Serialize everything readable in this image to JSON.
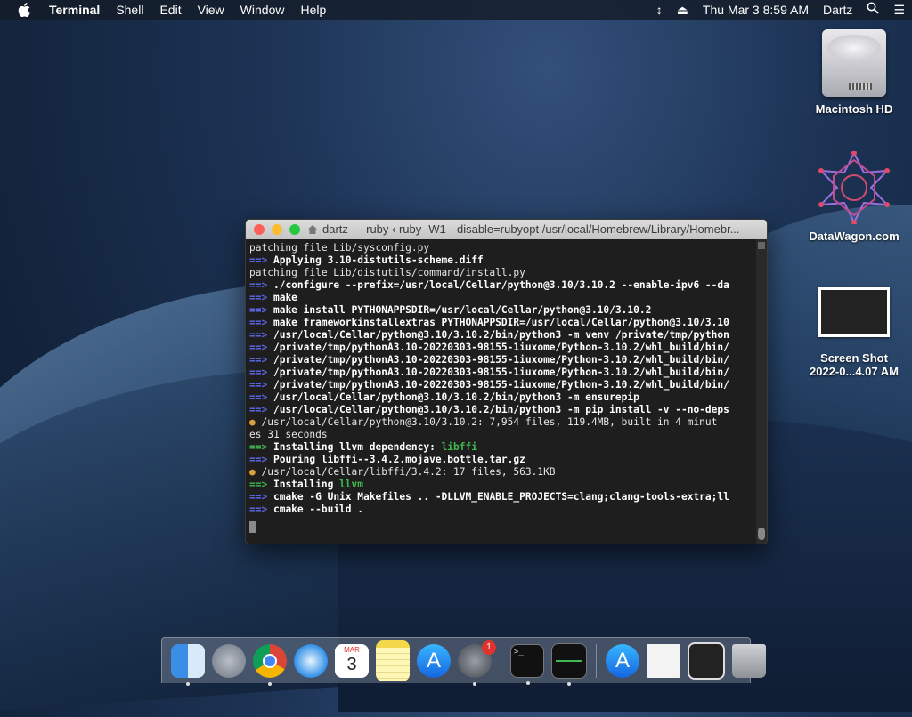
{
  "menubar": {
    "app_name": "Terminal",
    "menus": [
      "Shell",
      "Edit",
      "View",
      "Window",
      "Help"
    ],
    "clock": "Thu Mar 3  8:59 AM",
    "user": "Dartz",
    "icons": [
      "apple-icon",
      "scroll-arrows-icon",
      "eject-icon",
      "spotlight-icon",
      "notification-list-icon"
    ]
  },
  "desktop": {
    "icons": [
      {
        "label": "Macintosh HD",
        "icon": "hard-drive-icon"
      },
      {
        "label": "DataWagon.com",
        "icon": "datawagon-icon"
      },
      {
        "label_line1": "Screen Shot",
        "label_line2": "2022-0...4.07 AM",
        "icon": "screenshot-file-icon"
      }
    ]
  },
  "terminal": {
    "title": "dartz — ruby ‹ ruby -W1 --disable=rubyopt /usr/local/Homebrew/Library/Homebr...",
    "lines": [
      {
        "t": "plain",
        "text": "patching file Lib/sysconfig.py"
      },
      {
        "t": "arrow",
        "text": "Applying 3.10-distutils-scheme.diff"
      },
      {
        "t": "plain",
        "text": "patching file Lib/distutils/command/install.py"
      },
      {
        "t": "arrow",
        "text": "./configure --prefix=/usr/local/Cellar/python@3.10/3.10.2 --enable-ipv6 --da"
      },
      {
        "t": "arrow",
        "text": "make"
      },
      {
        "t": "arrow",
        "text": "make install PYTHONAPPSDIR=/usr/local/Cellar/python@3.10/3.10.2"
      },
      {
        "t": "arrow",
        "text": "make frameworkinstallextras PYTHONAPPSDIR=/usr/local/Cellar/python@3.10/3.10"
      },
      {
        "t": "arrow",
        "text": "/usr/local/Cellar/python@3.10/3.10.2/bin/python3 -m venv /private/tmp/python"
      },
      {
        "t": "arrow",
        "text": "/private/tmp/pythonA3.10-20220303-98155-1iuxome/Python-3.10.2/whl_build/bin/"
      },
      {
        "t": "arrow",
        "text": "/private/tmp/pythonA3.10-20220303-98155-1iuxome/Python-3.10.2/whl_build/bin/"
      },
      {
        "t": "arrow",
        "text": "/private/tmp/pythonA3.10-20220303-98155-1iuxome/Python-3.10.2/whl_build/bin/"
      },
      {
        "t": "arrow",
        "text": "/private/tmp/pythonA3.10-20220303-98155-1iuxome/Python-3.10.2/whl_build/bin/"
      },
      {
        "t": "arrow",
        "text": "/usr/local/Cellar/python@3.10/3.10.2/bin/python3 -m ensurepip"
      },
      {
        "t": "arrow",
        "text": "/usr/local/Cellar/python@3.10/3.10.2/bin/python3 -m pip install -v --no-deps"
      },
      {
        "t": "beer",
        "text": "/usr/local/Cellar/python@3.10/3.10.2: 7,954 files, 119.4MB, built in 4 minut"
      },
      {
        "t": "plain",
        "text": "es 31 seconds"
      },
      {
        "t": "garrow",
        "text": "Installing llvm dependency: ",
        "hl": "libffi"
      },
      {
        "t": "arrow",
        "text": "Pouring libffi--3.4.2.mojave.bottle.tar.gz"
      },
      {
        "t": "beer",
        "text": "/usr/local/Cellar/libffi/3.4.2: 17 files, 563.1KB"
      },
      {
        "t": "garrow",
        "text": "Installing ",
        "hl": "llvm"
      },
      {
        "t": "arrow",
        "text": "cmake -G Unix Makefiles .. -DLLVM_ENABLE_PROJECTS=clang;clang-tools-extra;ll"
      },
      {
        "t": "arrow",
        "text": "cmake --build ."
      }
    ],
    "prompt_marker": "==>",
    "beer_glyph": "🍺"
  },
  "dock": {
    "apps": [
      {
        "name": "Finder",
        "icon": "finder-icon",
        "running": true
      },
      {
        "name": "Launchpad",
        "icon": "launchpad-icon",
        "running": false
      },
      {
        "name": "Google Chrome",
        "icon": "chrome-icon",
        "running": true
      },
      {
        "name": "Safari",
        "icon": "safari-icon",
        "running": false
      },
      {
        "name": "Calendar",
        "icon": "calendar-icon",
        "running": false,
        "month": "MAR",
        "day": "3"
      },
      {
        "name": "Notes",
        "icon": "notes-icon",
        "running": false
      },
      {
        "name": "App Store",
        "icon": "app-store-icon",
        "running": false
      },
      {
        "name": "System Preferences",
        "icon": "system-preferences-icon",
        "running": true,
        "badge": "1"
      },
      {
        "name": "Terminal",
        "icon": "terminal-icon",
        "running": true,
        "glyph": ">_"
      },
      {
        "name": "Activity Monitor",
        "icon": "activity-monitor-icon",
        "running": true
      },
      {
        "name": "Applications",
        "icon": "applications-folder-icon",
        "running": false
      },
      {
        "name": "Document",
        "icon": "document-icon",
        "running": false
      },
      {
        "name": "Screen Shot",
        "icon": "screenshot-stack-icon",
        "running": false
      },
      {
        "name": "Trash",
        "icon": "trash-icon",
        "running": false
      }
    ]
  },
  "colors": {
    "arrow_blue": "#5b6af0",
    "arrow_green": "#3fb950",
    "terminal_bg": "#1e1e1e",
    "badge_red": "#e0322e"
  }
}
